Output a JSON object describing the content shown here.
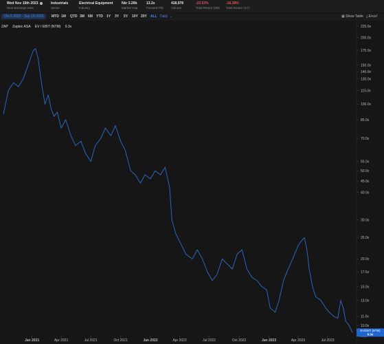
{
  "header": {
    "metrics": [
      {
        "value": "Wed Nov 15th 2023",
        "label": "Next Earnings Date",
        "info": true
      },
      {
        "value": "Industrials",
        "label": "Sector"
      },
      {
        "value": "Electrical Equipment",
        "label": "Industry"
      },
      {
        "value": "Nkr 2.29b",
        "label": "Market Cap"
      },
      {
        "value": "13.2x",
        "label": "Forward P/E"
      },
      {
        "value": "418,978",
        "label": "Volume"
      },
      {
        "value": "-22.53%",
        "label": "Total Return (3M)",
        "negative": true
      },
      {
        "value": "-16.38%",
        "label": "Total Return (1Y)",
        "negative": true
      }
    ]
  },
  "toolbar": {
    "date_range": "Oct 5 2020 - Sep 15 2023",
    "ranges": [
      "MTD",
      "1M",
      "QTD",
      "3M",
      "6M",
      "YTD",
      "1Y",
      "3Y",
      "5Y",
      "10Y",
      "20Y",
      "ALL"
    ],
    "active_range": "ALL",
    "frequency": "Daily",
    "show_table": "Show Table",
    "excel": "Excel"
  },
  "legend": {
    "ticker": "ZAP",
    "company": "Zaptec ASA",
    "metric": "EV / EBIT (NTM)",
    "value": "9.3x"
  },
  "chart_data": {
    "type": "line",
    "title": "",
    "xlabel": "",
    "ylabel": "",
    "yscale": "log",
    "ylim": [
      9,
      225
    ],
    "y_ticks": [
      "225.0x",
      "200.0x",
      "175.0x",
      "150.0x",
      "140.0x",
      "130.0x",
      "115.0x",
      "100.0x",
      "85.0x",
      "70.0x",
      "55.0x",
      "50.0x",
      "45.0x",
      "40.0x",
      "30.0x",
      "25.0x",
      "20.0x",
      "17.5x",
      "15.0x",
      "13.0x",
      "11.0x",
      "10.0x",
      "9.0x"
    ],
    "x_ticks": [
      "Jan 2021",
      "Apr 2021",
      "Jul 2021",
      "Oct 2021",
      "Jan 2022",
      "Apr 2022",
      "Jul 2022",
      "Oct 2022",
      "Jan 2023",
      "Apr 2023",
      "Jul 2023"
    ],
    "series": [
      {
        "name": "EV / EBIT (NTM)",
        "color": "#2f6fcf",
        "points": [
          [
            "2020-10-05",
            90
          ],
          [
            "2020-10-20",
            115
          ],
          [
            "2020-11-05",
            125
          ],
          [
            "2020-11-20",
            120
          ],
          [
            "2020-12-05",
            130
          ],
          [
            "2020-12-20",
            150
          ],
          [
            "2021-01-05",
            175
          ],
          [
            "2021-01-12",
            178
          ],
          [
            "2021-01-20",
            160
          ],
          [
            "2021-02-01",
            120
          ],
          [
            "2021-02-10",
            100
          ],
          [
            "2021-02-20",
            110
          ],
          [
            "2021-03-01",
            95
          ],
          [
            "2021-03-10",
            88
          ],
          [
            "2021-03-20",
            92
          ],
          [
            "2021-04-01",
            78
          ],
          [
            "2021-04-15",
            85
          ],
          [
            "2021-05-01",
            72
          ],
          [
            "2021-05-15",
            65
          ],
          [
            "2021-06-01",
            68
          ],
          [
            "2021-06-15",
            60
          ],
          [
            "2021-07-01",
            55
          ],
          [
            "2021-07-15",
            65
          ],
          [
            "2021-08-01",
            70
          ],
          [
            "2021-08-15",
            78
          ],
          [
            "2021-09-01",
            72
          ],
          [
            "2021-09-15",
            80
          ],
          [
            "2021-10-01",
            68
          ],
          [
            "2021-10-15",
            62
          ],
          [
            "2021-11-01",
            50
          ],
          [
            "2021-11-15",
            48
          ],
          [
            "2021-12-01",
            44
          ],
          [
            "2021-12-15",
            48
          ],
          [
            "2022-01-01",
            46
          ],
          [
            "2022-01-15",
            50
          ],
          [
            "2022-02-01",
            48
          ],
          [
            "2022-02-15",
            52
          ],
          [
            "2022-03-01",
            42
          ],
          [
            "2022-03-08",
            30
          ],
          [
            "2022-03-20",
            26
          ],
          [
            "2022-04-01",
            24
          ],
          [
            "2022-04-20",
            21
          ],
          [
            "2022-05-10",
            20
          ],
          [
            "2022-05-25",
            22
          ],
          [
            "2022-06-10",
            20
          ],
          [
            "2022-06-25",
            17.5
          ],
          [
            "2022-07-10",
            16
          ],
          [
            "2022-07-25",
            17
          ],
          [
            "2022-08-10",
            20
          ],
          [
            "2022-08-25",
            19
          ],
          [
            "2022-09-10",
            18
          ],
          [
            "2022-09-25",
            21
          ],
          [
            "2022-10-10",
            22
          ],
          [
            "2022-10-25",
            18
          ],
          [
            "2022-11-10",
            16.5
          ],
          [
            "2022-11-25",
            16
          ],
          [
            "2022-12-10",
            15
          ],
          [
            "2022-12-25",
            14.5
          ],
          [
            "2023-01-05",
            12
          ],
          [
            "2023-01-20",
            11.5
          ],
          [
            "2023-02-01",
            13
          ],
          [
            "2023-02-15",
            16
          ],
          [
            "2023-03-01",
            18
          ],
          [
            "2023-03-15",
            20
          ],
          [
            "2023-04-01",
            23
          ],
          [
            "2023-04-10",
            24
          ],
          [
            "2023-04-20",
            25
          ],
          [
            "2023-04-28",
            22
          ],
          [
            "2023-05-05",
            18
          ],
          [
            "2023-05-15",
            15
          ],
          [
            "2023-05-25",
            13.5
          ],
          [
            "2023-06-10",
            13
          ],
          [
            "2023-06-25",
            12
          ],
          [
            "2023-07-05",
            11.5
          ],
          [
            "2023-07-20",
            11
          ],
          [
            "2023-08-01",
            10.8
          ],
          [
            "2023-08-10",
            13
          ],
          [
            "2023-08-18",
            12
          ],
          [
            "2023-08-25",
            10.5
          ],
          [
            "2023-09-05",
            10
          ],
          [
            "2023-09-15",
            9.3
          ]
        ]
      }
    ],
    "last_value_label": {
      "title": "EV/EBIT (NTM)",
      "value": "9.3x"
    }
  }
}
